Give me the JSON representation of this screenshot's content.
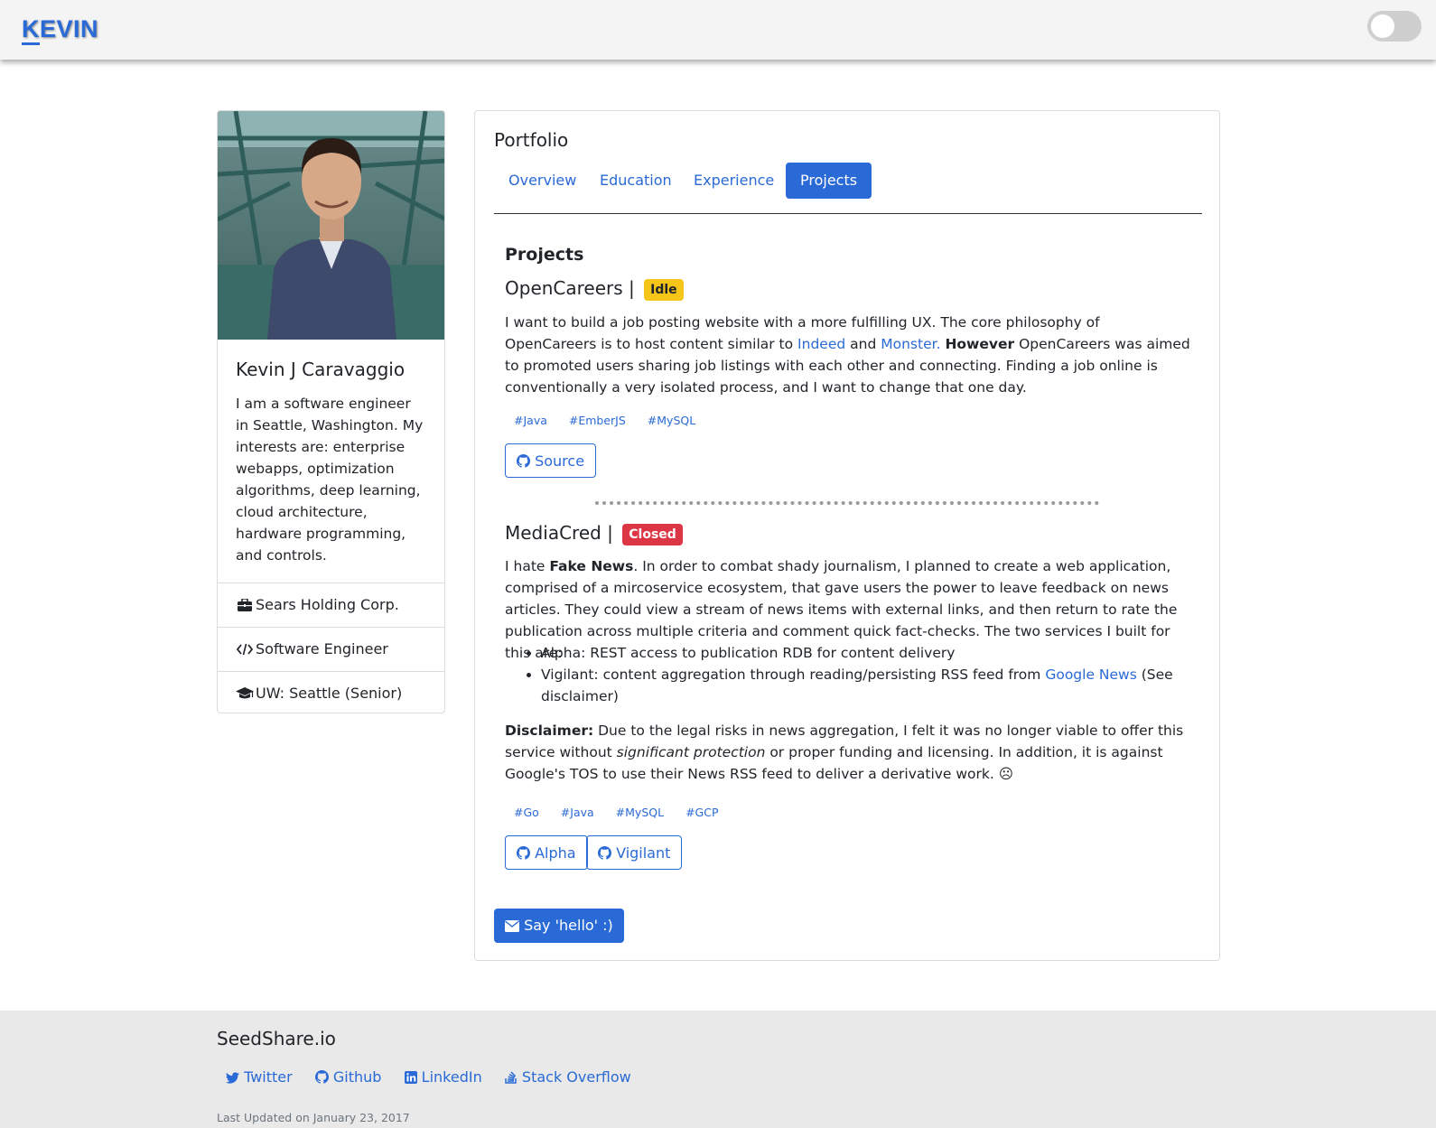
{
  "navbar": {
    "brand_first": "K",
    "brand_rest": "EVIN"
  },
  "profile": {
    "name": "Kevin J Caravaggio",
    "bio": "I am a software engineer in Seattle, Washington. My interests are: enterprise webapps, optimization algorithms, deep learning, cloud architecture, hardware programming, and controls.",
    "items": [
      {
        "icon": "briefcase-icon",
        "label": "Sears Holding Corp."
      },
      {
        "icon": "code-icon",
        "label": "Software Engineer"
      },
      {
        "icon": "graduation-cap-icon",
        "label": "UW: Seattle (Senior)"
      }
    ]
  },
  "portfolio": {
    "title": "Portfolio",
    "tabs": [
      "Overview",
      "Education",
      "Experience",
      "Projects"
    ],
    "active_tab": "Projects",
    "section_title": "Projects",
    "projects": [
      {
        "name": "OpenCareers |",
        "status": "Idle",
        "desc_1": "I want to build a job posting website with a more fulfilling UX. The core philosophy of OpenCareers is to host content similar to",
        "link_indeed": "Indeed",
        "and": "and",
        "link_monster": "Monster.",
        "however": "However",
        "desc_2": "OpenCareers was aimed to promoted users sharing job listings with each other and connecting. Finding a job online is conventionally a very isolated process, and I want to change that one day.",
        "tags": [
          "#Java",
          "#EmberJS",
          "#MySQL"
        ],
        "buttons": [
          "Source"
        ]
      },
      {
        "name": "MediaCred |",
        "status": "Closed",
        "i_hate": "I hate",
        "fake_news": "Fake News",
        "desc_1": ". In order to combat shady journalism, I planned to create a web application, comprised of a mircoservice ecosystem, that gave users the power to leave feedback on news articles. They could view a stream of news items with external links, and then return to rate the publication across multiple criteria and comment quick fact-checks. The two services I built for this are:",
        "bullet_1": "Alpha: REST access to publication RDB for content delivery",
        "bullet_2_pre": "Vigilant: content aggregation through reading/persisting RSS feed from",
        "bullet_2_link": "Google News",
        "bullet_2_post": "(See disclaimer)",
        "disclaimer_label": "Disclaimer:",
        "disclaimer_1": "Due to the legal risks in news aggregation, I felt it was no longer viable to offer this service without",
        "disclaimer_em": "significant protection",
        "disclaimer_2": "or proper funding and licensing. In addition, it is against Google's TOS to use their News RSS feed to deliver a derivative work. ☹",
        "tags": [
          "#Go",
          "#Java",
          "#MySQL",
          "#GCP"
        ],
        "buttons": [
          "Alpha",
          "Vigilant"
        ]
      }
    ],
    "contact_button": "Say 'hello' :)"
  },
  "footer": {
    "title": "SeedShare.io",
    "links": [
      "Twitter",
      "Github",
      "LinkedIn",
      "Stack Overflow"
    ],
    "updated": "Last Updated on January 23, 2017"
  },
  "colors": {
    "accent": "#2a6ad6",
    "idle": "#f5c518",
    "closed": "#dc3545"
  }
}
